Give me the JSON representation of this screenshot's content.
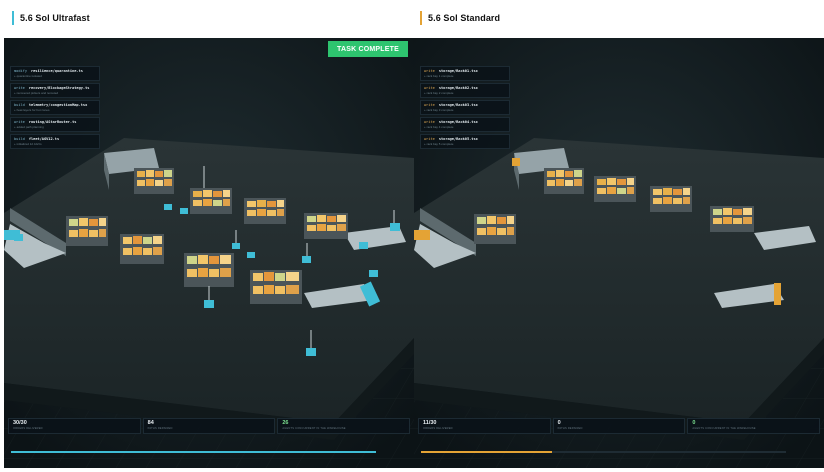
{
  "labels": {
    "left": "5.6 Sol Ultrafast",
    "right": "5.6 Sol Standard"
  },
  "colors": {
    "ultrafast_accent": "#3fbdd6",
    "standard_accent": "#e4a335",
    "complete_green": "#2ec46f"
  },
  "left": {
    "badge": "TASK COMPLETE",
    "log": [
      {
        "verb": "modify",
        "path": "resilience/quarantine.ts",
        "meta": "+ quarantine isolated"
      },
      {
        "verb": "write",
        "path": "recovery/BlockageStrategy.ts",
        "meta": "+ recovered pickers and rerouted"
      },
      {
        "verb": "build",
        "path": "telemetry/congestionMap.tsx",
        "meta": "+ heat layers for hot zones"
      },
      {
        "verb": "write",
        "path": "routing/AStarRouter.ts",
        "meta": "+ added path planning"
      },
      {
        "verb": "build",
        "path": "fleet/AGV12.ts",
        "meta": "+ initialized 12 AGVs"
      }
    ],
    "stats": [
      {
        "value": "30/30",
        "label": "ORDERS DELIVERED"
      },
      {
        "value": "84",
        "label": "PATHS REPAIRED"
      },
      {
        "value": "26",
        "label": "AGENTS CONCURRENT IN THE WAREHOUSE"
      }
    ],
    "progress": 1.0
  },
  "right": {
    "log": [
      {
        "verb": "write",
        "path": "storage/Rack01.tsx",
        "meta": "+ rack bay 1 complete"
      },
      {
        "verb": "write",
        "path": "storage/Rack02.tsx",
        "meta": "+ rack bay 2 complete"
      },
      {
        "verb": "write",
        "path": "storage/Rack03.tsx",
        "meta": "+ rack bay 3 complete"
      },
      {
        "verb": "write",
        "path": "storage/Rack04.tsx",
        "meta": "+ rack bay 4 complete"
      },
      {
        "verb": "write",
        "path": "storage/Rack05.tsx",
        "meta": "+ rack bay 5 complete"
      }
    ],
    "stats": [
      {
        "value": "11/30",
        "label": "ORDERS DELIVERED"
      },
      {
        "value": "0",
        "label": "PATHS REPAIRED"
      },
      {
        "value": "0",
        "label": "AGENTS CONCURRENT IN THE WAREHOUSE"
      }
    ],
    "progress": 0.36
  }
}
